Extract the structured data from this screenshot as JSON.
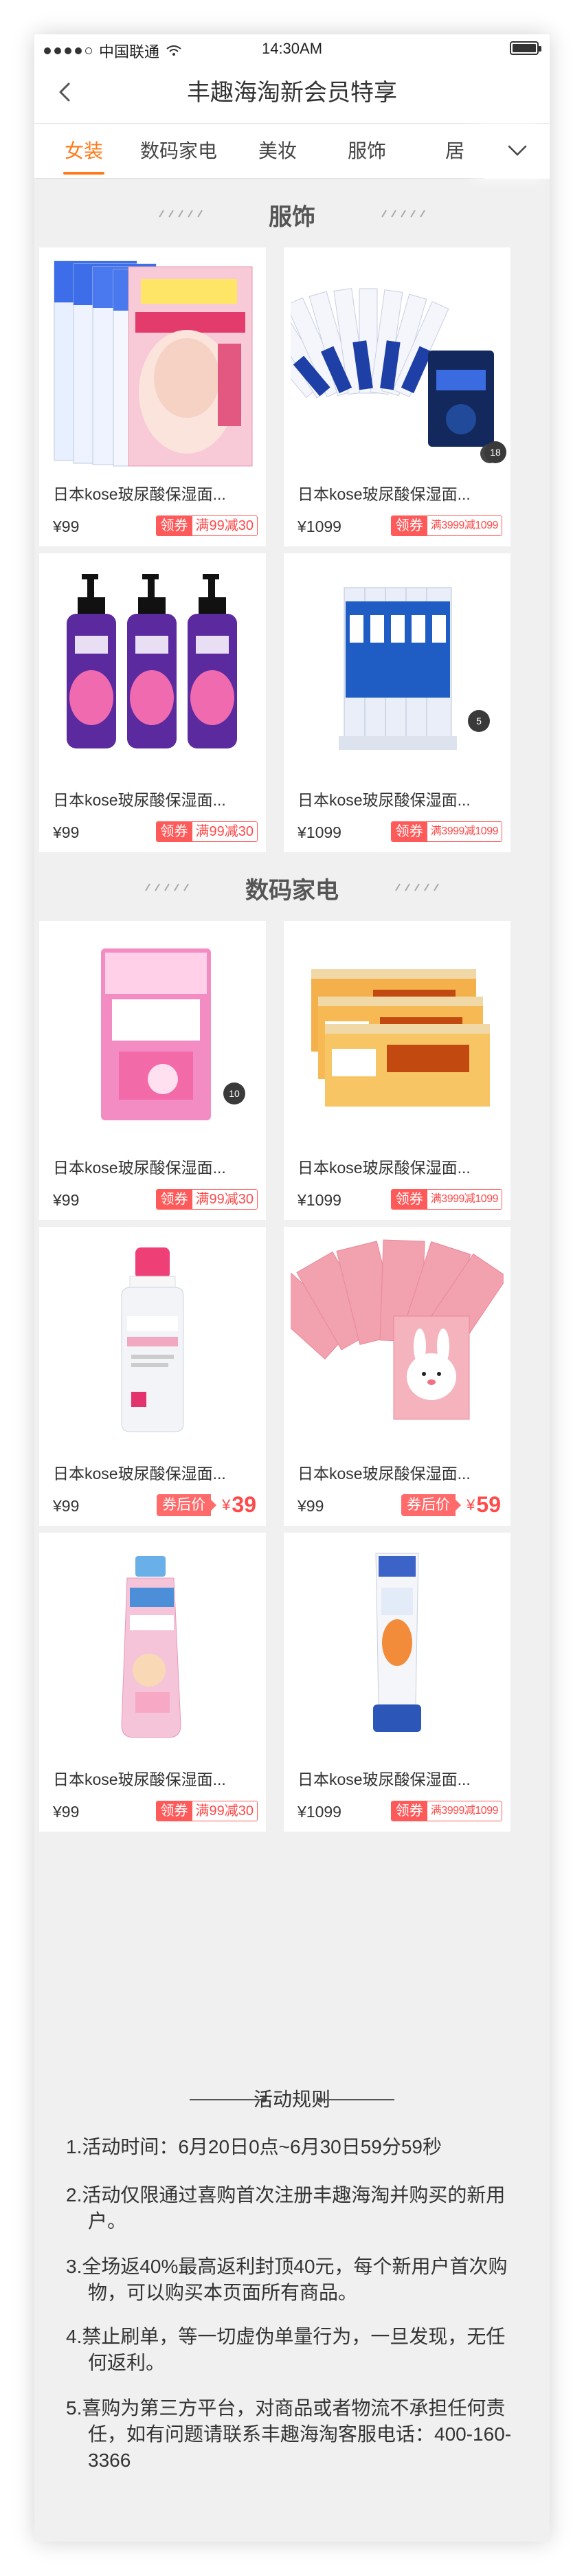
{
  "status_bar": {
    "carrier": "中国联通",
    "time": "14:30AM"
  },
  "nav": {
    "title": "丰趣海淘新会员特享",
    "back_icon": "chevron-left-icon"
  },
  "tabs": [
    "女装",
    "数码家电",
    "美妆",
    "服饰",
    "居"
  ],
  "tab_active": "女装",
  "sections": [
    {
      "title": "服饰"
    },
    {
      "title": "数码家电"
    }
  ],
  "products": [
    {
      "name": "日本kose玻尿酸保湿面...",
      "price": "¥99",
      "coupon_label": "领券",
      "coupon_value": "满99减30",
      "image": "pink-face-mask-packs"
    },
    {
      "name": "日本kose玻尿酸保湿面...",
      "price": "¥1099",
      "coupon_label": "领券",
      "coupon_value": "满3999减1099",
      "image": "blue-sheet-mask-fan",
      "badge": "18"
    },
    {
      "name": "日本kose玻尿酸保湿面...",
      "price": "¥99",
      "coupon_label": "领券",
      "coupon_value": "满99减30",
      "image": "purple-body-wash-bottles"
    },
    {
      "name": "日本kose玻尿酸保湿面...",
      "price": "¥1099",
      "coupon_label": "领券",
      "coupon_value": "满3999减1099",
      "image": "blue-toothpaste-tubes",
      "badge": "5"
    },
    {
      "name": "日本kose玻尿酸保湿面...",
      "price": "¥99",
      "coupon_label": "领券",
      "coupon_value": "满99减30",
      "image": "pink-tampon-box",
      "badge": "10"
    },
    {
      "name": "日本kose玻尿酸保湿面...",
      "price": "¥1099",
      "coupon_label": "领券",
      "coupon_value": "满3999减1099",
      "image": "orange-slim-boxes"
    },
    {
      "name": "日本kose玻尿酸保湿面...",
      "price": "¥99",
      "after_label": "券后价",
      "after_currency": "¥",
      "after_value": "39",
      "image": "bioderma-micellar-water"
    },
    {
      "name": "日本kose玻尿酸保湿面...",
      "price": "¥99",
      "after_label": "券后价",
      "after_currency": "¥",
      "after_value": "59",
      "image": "pink-bunny-masks"
    },
    {
      "name": "日本kose玻尿酸保湿面...",
      "price": "¥99",
      "coupon_label": "领券",
      "coupon_value": "满99减30",
      "image": "coppertone-spray"
    },
    {
      "name": "日本kose玻尿酸保湿面...",
      "price": "¥1099",
      "coupon_label": "领券",
      "coupon_value": "满3999减1099",
      "image": "white-cleanser-tube"
    }
  ],
  "rules": {
    "title": "活动规则",
    "items": [
      "1.活动时间：6月20日0点~6月30日59分59秒",
      "2.活动仅限通过喜购首次注册丰趣海淘并购买的新用户。",
      "3.全场返40%最高返利封顶40元，每个新用户首次购物，可以购买本页面所有商品。",
      "4.禁止刷单，等一切虚伪单量行为，一旦发现，无任何返利。",
      "5.喜购为第三方平台，对商品或者物流不承担任何责任，如有问题请联系丰趣海淘客服电话：400-160-3366"
    ]
  },
  "colors": {
    "accent": "#ff7a1a",
    "coupon": "#ff5a5a",
    "background": "#f0f0f0"
  }
}
